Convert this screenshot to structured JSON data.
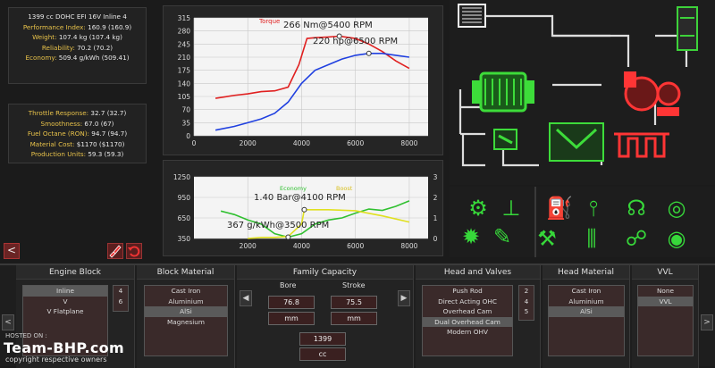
{
  "engine_stats": [
    {
      "text": "1399 cc DOHC EFI 16V Inline 4",
      "color": "#e8e8e8"
    },
    {
      "label": "Performance Index: ",
      "value": "160.9 (160.9)"
    },
    {
      "label": "Weight: ",
      "value": "107.4 kg (107.4 kg)"
    },
    {
      "label": "Reliability: ",
      "value": "70.2 (70.2)"
    },
    {
      "label": "Economy: ",
      "value": "509.4 g/kWh (509.41)"
    }
  ],
  "quality_stats": [
    {
      "label": "Throttle Response: ",
      "value": "32.7 (32.7)"
    },
    {
      "label": "Smoothness: ",
      "value": "67.0 (67)"
    },
    {
      "label": "Fuel Octane (RON): ",
      "value": "94.7 (94.7)"
    },
    {
      "label": "Material Cost: ",
      "value": "$1170 ($1170)"
    },
    {
      "label": "Production Units: ",
      "value": "59.3 (59.3)"
    }
  ],
  "buttons": {
    "back": "<",
    "next": ">"
  },
  "bottom": {
    "engine_block": {
      "title": "Engine Block",
      "items": [
        "Inline",
        "V",
        "V Flatplane"
      ],
      "counts": [
        "4",
        "6"
      ],
      "selected": 0
    },
    "block_material": {
      "title": "Block Material",
      "items": [
        "Cast Iron",
        "Aluminium",
        "AlSi",
        "Magnesium"
      ],
      "selected": 2
    },
    "family_capacity": {
      "title": "Family Capacity",
      "bore_label": "Bore",
      "bore_value": "76.8",
      "bore_unit": "mm",
      "stroke_label": "Stroke",
      "stroke_value": "75.5",
      "stroke_unit": "mm",
      "capacity_value": "1399",
      "capacity_unit": "cc"
    },
    "head_and_valves": {
      "title": "Head and Valves",
      "items": [
        "Push Rod",
        "Direct Acting OHC",
        "Overhead Cam",
        "Dual Overhead Cam",
        "Modern OHV"
      ],
      "counts": [
        "2",
        "4",
        "5"
      ],
      "selected": 3
    },
    "head_material": {
      "title": "Head Material",
      "items": [
        "Cast Iron",
        "Aluminium",
        "AlSi"
      ],
      "selected": 2
    },
    "vvl": {
      "title": "VVL",
      "items": [
        "None",
        "VVL"
      ],
      "selected": 1
    }
  },
  "chart_data": [
    {
      "type": "line",
      "x_ticks": [
        0,
        2000,
        4000,
        6000,
        8000
      ],
      "y_ticks": [
        0,
        35,
        70,
        105,
        140,
        175,
        210,
        245,
        280,
        315
      ],
      "xlim": [
        0,
        8700
      ],
      "ylim": [
        0,
        315
      ],
      "legend": [
        "Torque"
      ],
      "annotations": [
        "266 Nm@5400 RPM",
        "220 hp@6500 RPM"
      ],
      "series": [
        {
          "name": "Torque",
          "color": "#e02020",
          "x": [
            800,
            1500,
            2000,
            2500,
            3000,
            3500,
            3900,
            4200,
            4500,
            5000,
            5400,
            6000,
            6500,
            7000,
            7500,
            8000
          ],
          "y": [
            100,
            108,
            112,
            118,
            120,
            130,
            190,
            260,
            262,
            264,
            266,
            260,
            245,
            225,
            200,
            180
          ]
        },
        {
          "color": "#2040e0",
          "x": [
            800,
            1500,
            2000,
            2500,
            3000,
            3500,
            4000,
            4500,
            5000,
            5500,
            6000,
            6500,
            7000,
            7500,
            8000
          ],
          "y": [
            15,
            25,
            35,
            45,
            60,
            90,
            140,
            175,
            190,
            205,
            215,
            220,
            220,
            215,
            210
          ]
        }
      ]
    },
    {
      "type": "line",
      "x_ticks": [
        2000,
        4000,
        6000,
        8000
      ],
      "y_ticks": [
        350,
        650,
        950,
        1250
      ],
      "y2_ticks": [
        0,
        1,
        2,
        3
      ],
      "xlim": [
        0,
        8700
      ],
      "ylim": [
        350,
        1250
      ],
      "y2lim": [
        0,
        3
      ],
      "legend": [
        "Economy",
        "Boost"
      ],
      "annotations": [
        "1.40 Bar@4100 RPM",
        "367 g/kWh@3500 RPM"
      ],
      "series": [
        {
          "name": "Economy",
          "color": "#30c030",
          "x": [
            1000,
            1500,
            2000,
            2500,
            3000,
            3500,
            4000,
            4500,
            5000,
            5500,
            6000,
            6500,
            7000,
            7500,
            8000
          ],
          "y": [
            750,
            700,
            620,
            560,
            420,
            370,
            420,
            560,
            620,
            650,
            720,
            780,
            760,
            820,
            900
          ]
        },
        {
          "name": "Boost",
          "color": "#e0e020",
          "axis": "y2",
          "x": [
            2000,
            2500,
            3000,
            3500,
            4000,
            4100,
            5000,
            6000,
            7000,
            8000
          ],
          "y": [
            0,
            0.05,
            0.05,
            0.1,
            0.7,
            1.4,
            1.4,
            1.35,
            1.1,
            0.8
          ]
        }
      ]
    }
  ],
  "watermark": {
    "line1": "Team-BHP.com",
    "line2": "copyright respective owners",
    "hosted": "HOSTED ON :"
  }
}
